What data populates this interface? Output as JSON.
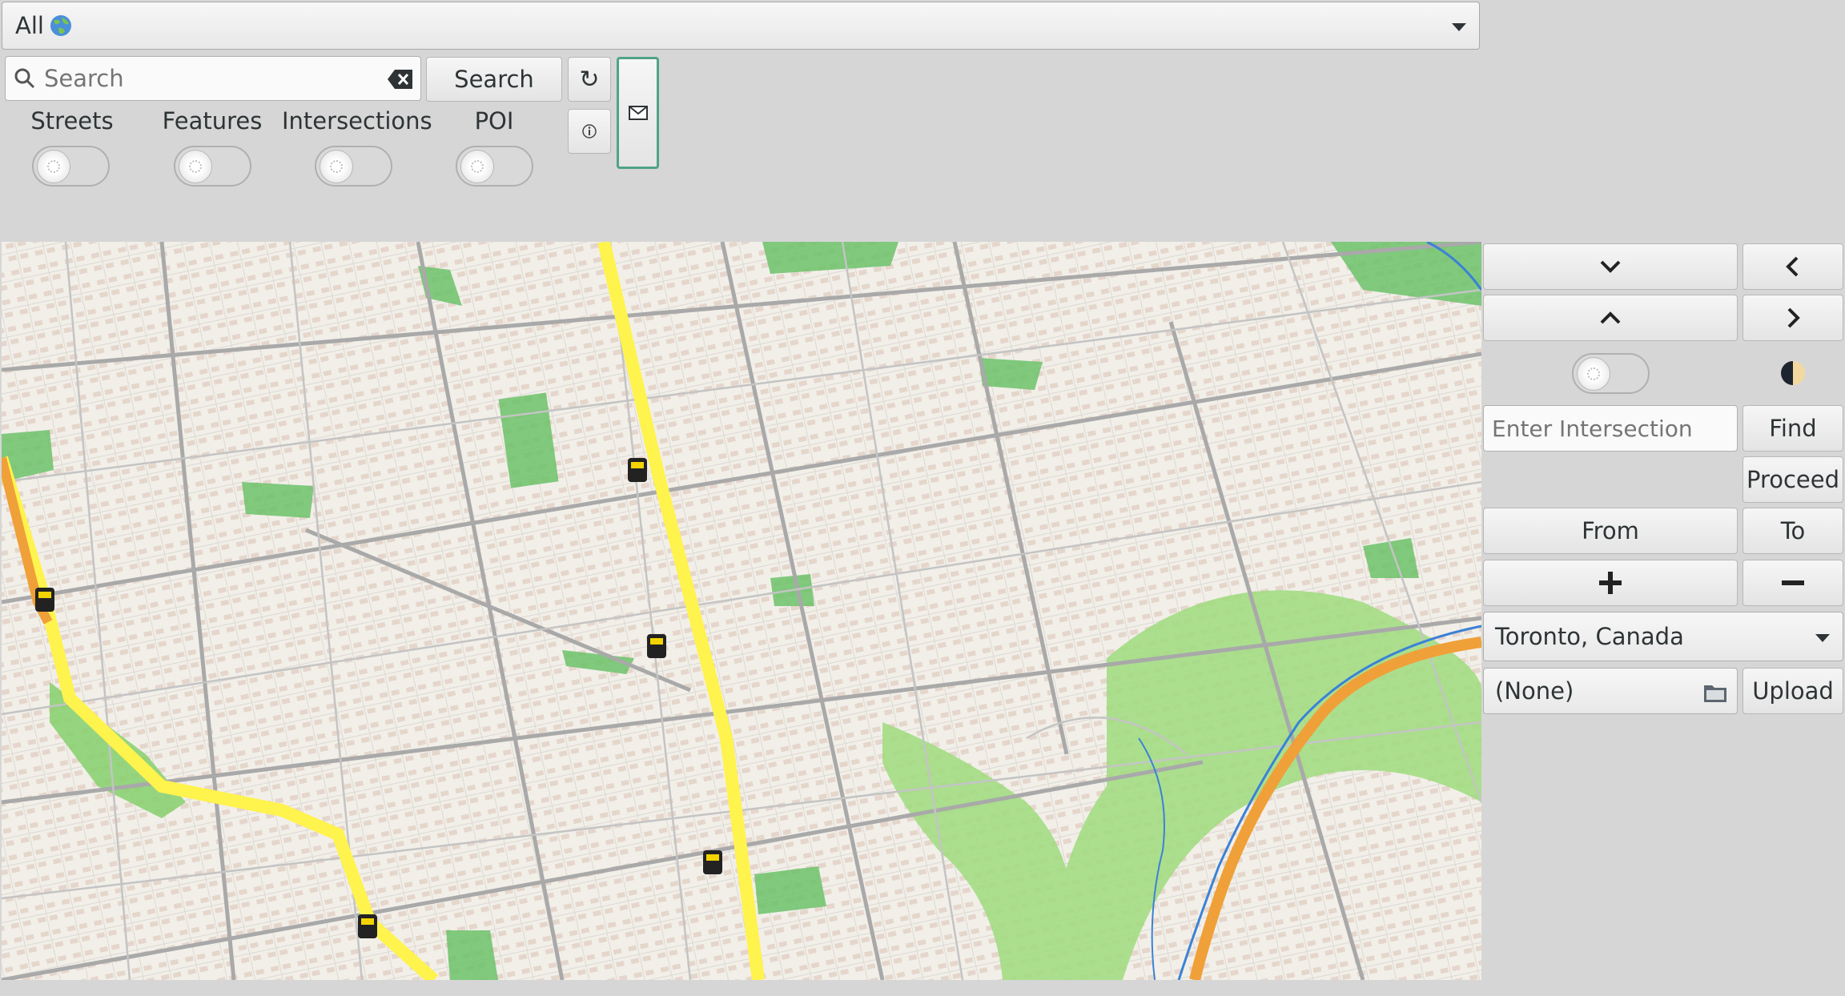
{
  "map_layers_dropdown": {
    "value": "All",
    "icon": "globe-icon"
  },
  "search": {
    "placeholder": "Search",
    "value": "",
    "button_label": "Search",
    "clear_icon": "backspace-clear-icon",
    "refresh_icon": "refresh-icon",
    "info_icon": "info-icon",
    "mail_icon": "envelope-icon"
  },
  "toggles": [
    {
      "label": "Streets",
      "on": false
    },
    {
      "label": "Features",
      "on": false
    },
    {
      "label": "Intersections",
      "on": false
    },
    {
      "label": "POI",
      "on": false
    }
  ],
  "side_panel": {
    "down_icon": "chevron-down-icon",
    "left_icon": "chevron-left-icon",
    "up_icon": "chevron-up-icon",
    "right_icon": "chevron-right-icon",
    "theme_toggle_on": false,
    "theme_icon": "half-moon-icon",
    "intersection_placeholder": "Enter Intersection",
    "find_label": "Find",
    "proceed_label": "Proceed",
    "from_label": "From",
    "to_label": "To",
    "zoom_in_icon": "plus-icon",
    "zoom_out_icon": "minus-icon",
    "city_value": "Toronto, Canada",
    "file_value": "(None)",
    "file_icon": "folder-icon",
    "upload_label": "Upload"
  },
  "colors": {
    "map_background": "#f2efe9",
    "park": "#6cc26a",
    "subway_line_1": "#fff34d",
    "subway_line_2": "#f0a038",
    "road": "#a9a9a9",
    "water": "#3b82d6",
    "focus_border": "#4fa387"
  }
}
